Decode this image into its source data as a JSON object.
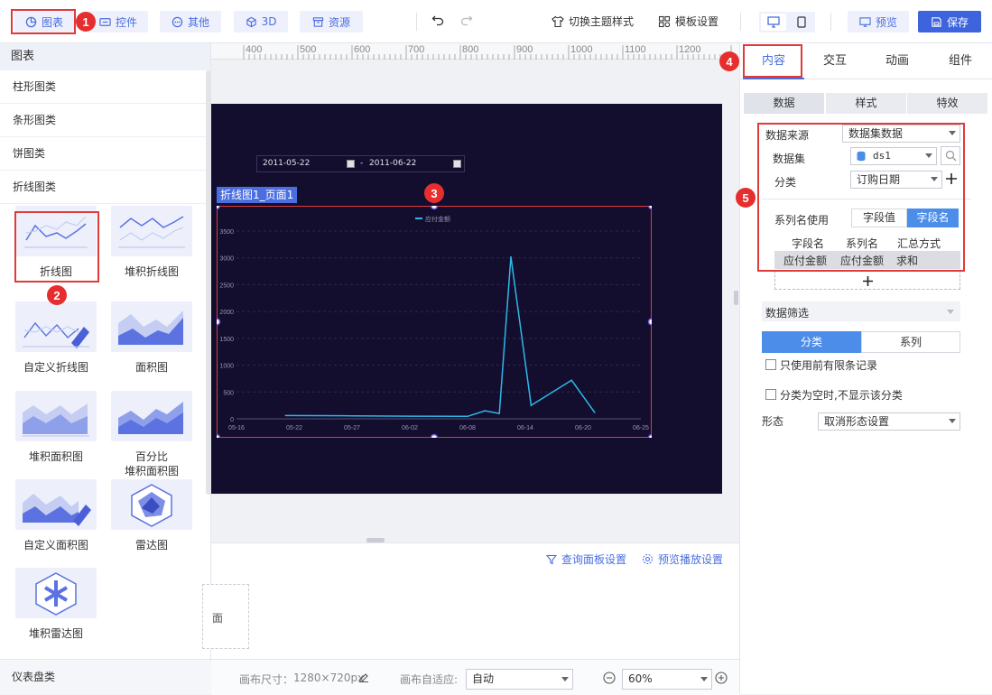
{
  "toolbar": {
    "chart": "图表",
    "control": "控件",
    "other": "其他",
    "three_d": "3D",
    "resource": "资源",
    "theme": "切换主题样式",
    "template": "模板设置",
    "preview": "预览",
    "save": "保存"
  },
  "badges": [
    "1",
    "2",
    "3",
    "4",
    "5"
  ],
  "left_panel": {
    "title": "图表",
    "categories": [
      "柱形图类",
      "条形图类",
      "饼图类",
      "折线图类"
    ],
    "charts": [
      "折线图",
      "堆积折线图",
      "自定义折线图",
      "面积图",
      "堆积面积图",
      "百分比",
      "堆积面积图",
      "自定义面积图",
      "雷达图",
      "堆积雷达图"
    ],
    "footer": "仪表盘类"
  },
  "ruler": [
    "400",
    "500",
    "600",
    "700",
    "800",
    "900",
    "1000",
    "1100",
    "1200"
  ],
  "canvas": {
    "date_from": "2011-05-22",
    "date_sep": "-",
    "date_to": "2011-06-22",
    "chart_label": "折线图1_页面1"
  },
  "chart_data": {
    "type": "line",
    "legend": "应付金额",
    "x_ticks": [
      "05-16",
      "05-22",
      "05-27",
      "06-02",
      "06-08",
      "06-14",
      "06-20",
      "06-25"
    ],
    "y_ticks": [
      "0",
      "500",
      "1000",
      "1500",
      "2000",
      "2500",
      "3000",
      "3500"
    ],
    "ylim": [
      0,
      3500
    ],
    "series": [
      {
        "name": "应付金额",
        "values": [
          {
            "x": 0.85,
            "y": 60
          },
          {
            "x": 2,
            "y": 55
          },
          {
            "x": 3,
            "y": 48
          },
          {
            "x": 4,
            "y": 45
          },
          {
            "x": 4.3,
            "y": 150
          },
          {
            "x": 4.55,
            "y": 100
          },
          {
            "x": 4.75,
            "y": 3020
          },
          {
            "x": 5.1,
            "y": 250
          },
          {
            "x": 5.8,
            "y": 720
          },
          {
            "x": 6.2,
            "y": 120
          }
        ]
      }
    ],
    "color": "#2fb8e8"
  },
  "bottom": {
    "query": "查询面板设置",
    "play": "预览播放设置",
    "page_stub": "面",
    "canvas_size_label": "画布尺寸：",
    "canvas_size": "1280×720px",
    "fit_label": "画布自适应:",
    "fit_value": "自动",
    "zoom": "60%"
  },
  "right_panel": {
    "tabs": [
      "内容",
      "交互",
      "动画",
      "组件"
    ],
    "subtabs": [
      "数据",
      "样式",
      "特效"
    ],
    "source_label": "数据来源",
    "source_value": "数据集数据",
    "dataset_label": "数据集",
    "dataset_value": "ds1",
    "category_label": "分类",
    "category_value": "订购日期",
    "series_name_label": "系列名使用",
    "series_opt1": "字段值",
    "series_opt2": "字段名",
    "table_headers": [
      "字段名",
      "系列名",
      "汇总方式"
    ],
    "table_row": [
      "应付金额",
      "应付金额",
      "求和"
    ],
    "filter_label": "数据筛选",
    "filter_tab1": "分类",
    "filter_tab2": "系列",
    "limit_text": "只使用前有限条记录",
    "empty_text": "分类为空时,不显示该分类",
    "shape_label": "形态",
    "shape_value": "取消形态设置"
  },
  "colors": {
    "accent": "#4a6de0",
    "red": "#e03a3a",
    "dark": "#130d2e",
    "line": "#2fb8e8"
  }
}
